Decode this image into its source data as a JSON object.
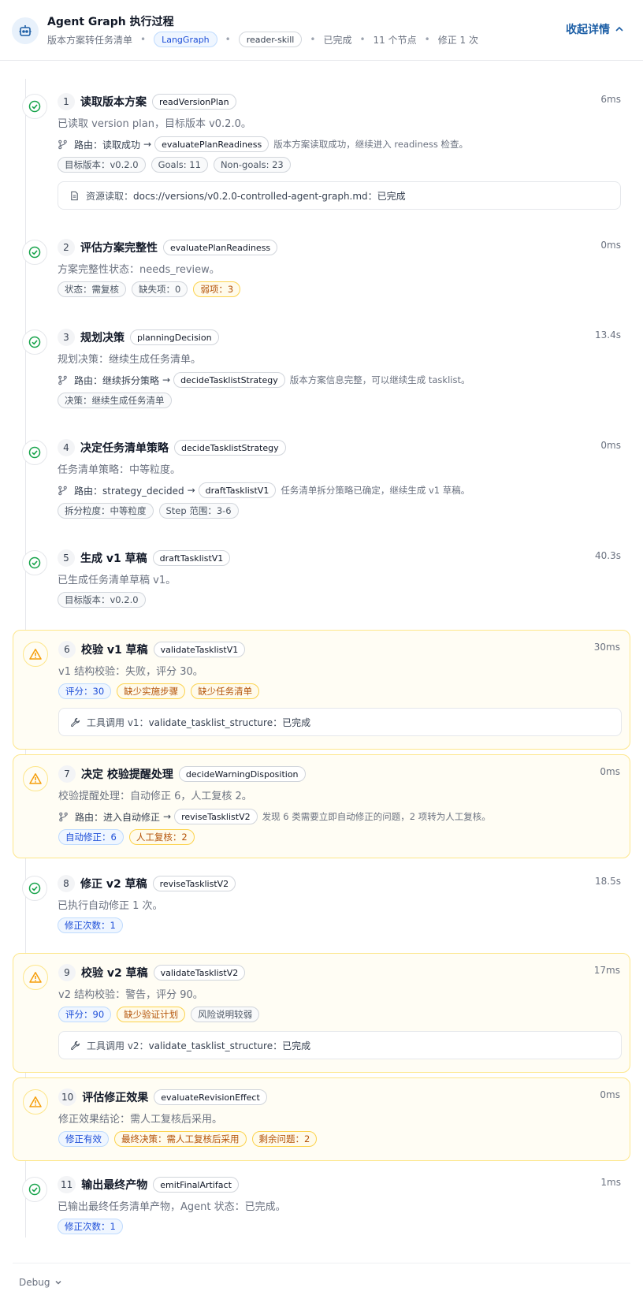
{
  "header": {
    "title": "Agent Graph 执行过程",
    "subtitle": "版本方案转任务清单",
    "framework": "LangGraph",
    "skill": "reader-skill",
    "status": "已完成",
    "node_count": "11 个节点",
    "revision_count": "修正 1 次",
    "collapse_label": "收起详情",
    "icon": "robot-icon"
  },
  "route_prefix": "路由：",
  "steps": [
    {
      "num": "1",
      "name": "读取版本方案",
      "code": "readVersionPlan",
      "duration": "6ms",
      "status": "success",
      "summary": "已读取 version plan，目标版本 v0.2.0。",
      "route": {
        "text": "读取成功",
        "target": "evaluatePlanReadiness",
        "note": "版本方案读取成功，继续进入 readiness 检查。"
      },
      "tags": [
        {
          "text": "目标版本：v0.2.0",
          "tone": "gray"
        },
        {
          "text": "Goals: 11",
          "tone": "gray"
        },
        {
          "text": "Non-goals: 23",
          "tone": "gray"
        }
      ],
      "box": {
        "label": "资源读取：",
        "value": "docs://versions/v0.2.0-controlled-agent-graph.md：已完成",
        "icon": "document-icon"
      }
    },
    {
      "num": "2",
      "name": "评估方案完整性",
      "code": "evaluatePlanReadiness",
      "duration": "0ms",
      "status": "success",
      "summary": "方案完整性状态：needs_review。",
      "tags": [
        {
          "text": "状态：需复核",
          "tone": "gray"
        },
        {
          "text": "缺失项：0",
          "tone": "gray"
        },
        {
          "text": "弱项：3",
          "tone": "amber"
        }
      ]
    },
    {
      "num": "3",
      "name": "规划决策",
      "code": "planningDecision",
      "duration": "13.4s",
      "status": "success",
      "summary": "规划决策：继续生成任务清单。",
      "route": {
        "text": "继续拆分策略",
        "target": "decideTasklistStrategy",
        "note": "版本方案信息完整，可以继续生成 tasklist。"
      },
      "tags": [
        {
          "text": "决策：继续生成任务清单",
          "tone": "gray"
        }
      ]
    },
    {
      "num": "4",
      "name": "决定任务清单策略",
      "code": "decideTasklistStrategy",
      "duration": "0ms",
      "status": "success",
      "summary": "任务清单策略：中等粒度。",
      "route": {
        "text": "strategy_decided",
        "target": "draftTasklistV1",
        "note": "任务清单拆分策略已确定，继续生成 v1 草稿。"
      },
      "tags": [
        {
          "text": "拆分粒度：中等粒度",
          "tone": "gray"
        },
        {
          "text": "Step 范围：3-6",
          "tone": "gray"
        }
      ]
    },
    {
      "num": "5",
      "name": "生成 v1 草稿",
      "code": "draftTasklistV1",
      "duration": "40.3s",
      "status": "success",
      "summary": "已生成任务清单草稿 v1。",
      "tags": [
        {
          "text": "目标版本：v0.2.0",
          "tone": "gray"
        }
      ]
    },
    {
      "num": "6",
      "name": "校验 v1 草稿",
      "code": "validateTasklistV1",
      "duration": "30ms",
      "status": "warning",
      "summary": "v1 结构校验：失败，评分 30。",
      "tags": [
        {
          "text": "评分：30",
          "tone": "blue"
        },
        {
          "text": "缺少实施步骤",
          "tone": "amber"
        },
        {
          "text": "缺少任务清单",
          "tone": "amber"
        }
      ],
      "box": {
        "label": "工具调用 v1：",
        "value": "validate_tasklist_structure：已完成",
        "icon": "wrench-icon"
      }
    },
    {
      "num": "7",
      "name": "决定 校验提醒处理",
      "code": "decideWarningDisposition",
      "duration": "0ms",
      "status": "warning",
      "summary": "校验提醒处理：自动修正 6，人工复核 2。",
      "route": {
        "text": "进入自动修正",
        "target": "reviseTasklistV2",
        "note": "发现 6 类需要立即自动修正的问题，2 项转为人工复核。"
      },
      "tags": [
        {
          "text": "自动修正：6",
          "tone": "blue"
        },
        {
          "text": "人工复核：2",
          "tone": "amber"
        }
      ]
    },
    {
      "num": "8",
      "name": "修正 v2 草稿",
      "code": "reviseTasklistV2",
      "duration": "18.5s",
      "status": "success",
      "summary": "已执行自动修正 1 次。",
      "tags": [
        {
          "text": "修正次数：1",
          "tone": "blue"
        }
      ]
    },
    {
      "num": "9",
      "name": "校验 v2 草稿",
      "code": "validateTasklistV2",
      "duration": "17ms",
      "status": "warning",
      "summary": "v2 结构校验：警告，评分 90。",
      "tags": [
        {
          "text": "评分：90",
          "tone": "blue"
        },
        {
          "text": "缺少验证计划",
          "tone": "amber"
        },
        {
          "text": "风险说明较弱",
          "tone": "gray"
        }
      ],
      "box": {
        "label": "工具调用 v2：",
        "value": "validate_tasklist_structure：已完成",
        "icon": "wrench-icon"
      }
    },
    {
      "num": "10",
      "name": "评估修正效果",
      "code": "evaluateRevisionEffect",
      "duration": "0ms",
      "status": "warning",
      "summary": "修正效果结论：需人工复核后采用。",
      "tags": [
        {
          "text": "修正有效",
          "tone": "blue"
        },
        {
          "text": "最终决策：需人工复核后采用",
          "tone": "amber"
        },
        {
          "text": "剩余问题：2",
          "tone": "amber"
        }
      ]
    },
    {
      "num": "11",
      "name": "输出最终产物",
      "code": "emitFinalArtifact",
      "duration": "1ms",
      "status": "success",
      "summary": "已输出最终任务清单产物，Agent 状态：已完成。",
      "tags": [
        {
          "text": "修正次数：1",
          "tone": "blue"
        }
      ]
    }
  ],
  "footer": {
    "debug_label": "Debug"
  },
  "colors": {
    "success": "#16a34a",
    "warning": "#f59e0b",
    "accent": "#1d5fa6"
  }
}
